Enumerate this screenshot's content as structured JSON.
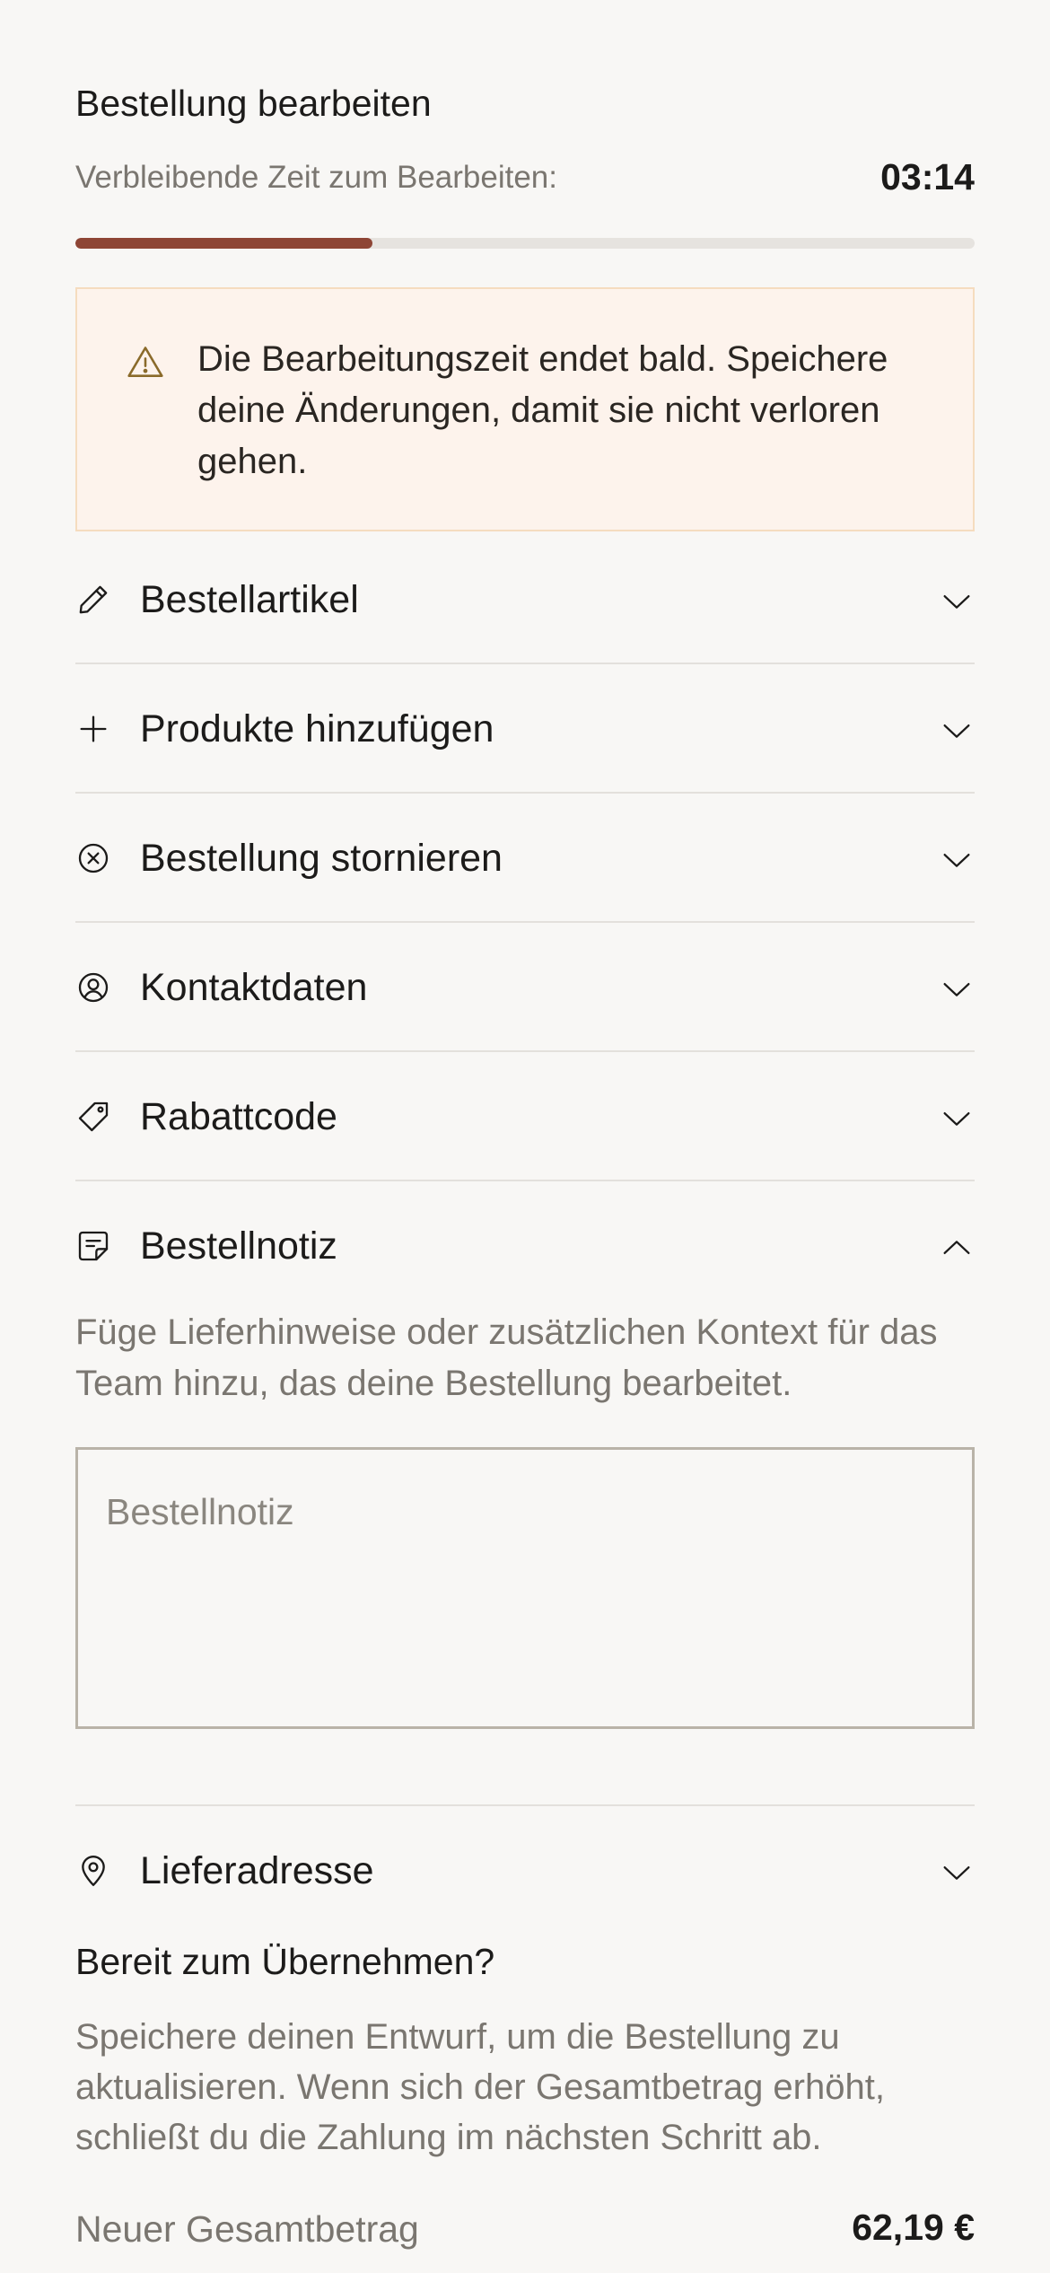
{
  "header": {
    "title": "Bestellung bearbeiten",
    "timer_label": "Verbleibende Zeit zum Bearbeiten:",
    "timer_value": "03:14",
    "progress_fraction": 0.33,
    "accent_color": "#8e4535"
  },
  "warning": {
    "icon": "warning-triangle-icon",
    "text": "Die Bearbeitungszeit endet bald. Speichere deine Änderungen, damit sie nicht verloren gehen."
  },
  "sections": [
    {
      "label": "Bestellartikel",
      "icon": "pencil-icon",
      "state": "collapsed"
    },
    {
      "label": "Produkte hinzufügen",
      "icon": "plus-icon",
      "state": "collapsed"
    },
    {
      "label": "Bestellung stornieren",
      "icon": "cancel-circle-icon",
      "state": "collapsed"
    },
    {
      "label": "Kontaktdaten",
      "icon": "user-circle-icon",
      "state": "collapsed"
    },
    {
      "label": "Rabattcode",
      "icon": "tag-icon",
      "state": "collapsed"
    },
    {
      "label": "Bestellnotiz",
      "icon": "note-icon",
      "state": "expanded"
    },
    {
      "label": "Lieferadresse",
      "icon": "location-pin-icon",
      "state": "collapsed"
    }
  ],
  "order_note": {
    "description": "Füge Lieferhinweise oder zusätzlichen Kontext für das Team hinzu, das deine Bestellung bearbeitet.",
    "placeholder": "Bestellnotiz",
    "value": ""
  },
  "commit": {
    "title": "Bereit zum Übernehmen?",
    "description": "Speichere deinen Entwurf, um die Bestellung zu aktualisieren. Wenn sich der Gesamtbetrag erhöht, schließt du die Zahlung im nächsten Schritt ab.",
    "total_label": "Neuer Gesamtbetrag",
    "total_value": "62,19 €"
  }
}
